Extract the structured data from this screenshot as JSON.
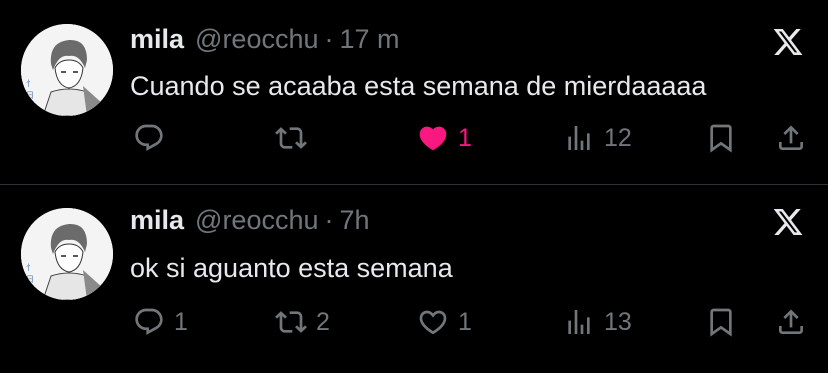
{
  "colors": {
    "background": "#000000",
    "text_primary": "#e7e9ea",
    "text_secondary": "#71767b",
    "like_active": "#f91880",
    "divider": "#2f3336"
  },
  "tweets": [
    {
      "display_name": "mila",
      "handle": "@reocchu",
      "separator": "·",
      "time": "17 m",
      "text": "Cuando se acaaba esta semana de mierdaaaaa",
      "platform_icon": "x-logo-icon",
      "actions": {
        "reply": {
          "icon": "reply-icon",
          "count": ""
        },
        "retweet": {
          "icon": "retweet-icon",
          "count": ""
        },
        "like": {
          "icon": "heart-filled-icon",
          "count": "1",
          "active": true
        },
        "views": {
          "icon": "views-icon",
          "count": "12"
        },
        "bookmark": {
          "icon": "bookmark-icon"
        },
        "share": {
          "icon": "share-icon"
        }
      }
    },
    {
      "display_name": "mila",
      "handle": "@reocchu",
      "separator": "·",
      "time": "7h",
      "text": "ok si aguanto esta semana",
      "platform_icon": "x-logo-icon",
      "actions": {
        "reply": {
          "icon": "reply-icon",
          "count": "1"
        },
        "retweet": {
          "icon": "retweet-icon",
          "count": "2"
        },
        "like": {
          "icon": "heart-outline-icon",
          "count": "1",
          "active": false
        },
        "views": {
          "icon": "views-icon",
          "count": "13"
        },
        "bookmark": {
          "icon": "bookmark-icon"
        },
        "share": {
          "icon": "share-icon"
        }
      }
    }
  ]
}
